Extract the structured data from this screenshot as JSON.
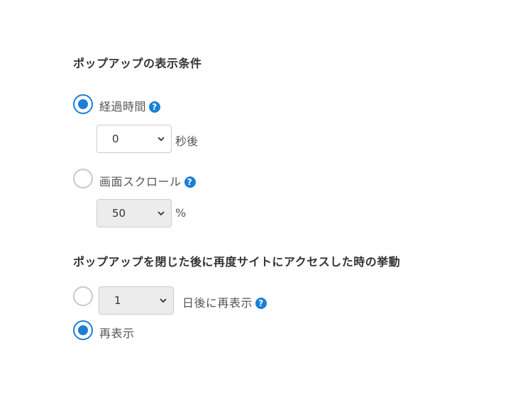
{
  "section1": {
    "title": "ポップアップの表示条件",
    "option_time": {
      "label": "経過時間",
      "checked": true
    },
    "delay_select": {
      "value": "0",
      "unit": "秒後"
    },
    "option_scroll": {
      "label": "画面スクロール",
      "checked": false
    },
    "scroll_select": {
      "value": "50",
      "unit": "%",
      "disabled": true
    }
  },
  "section2": {
    "title": "ポップアップを閉じた後に再度サイトにアクセスした時の挙動",
    "option_redisplay_days": {
      "checked": false,
      "value": "1",
      "suffix": "日後に再表示"
    },
    "option_redisplay": {
      "label": "再表示",
      "checked": true
    }
  },
  "icons": {
    "help": "question-circle-icon",
    "chevron": "chevron-down-icon"
  },
  "colors": {
    "accent": "#1a7fd6",
    "disabled_bg": "#ececec",
    "border": "#cccccc"
  }
}
